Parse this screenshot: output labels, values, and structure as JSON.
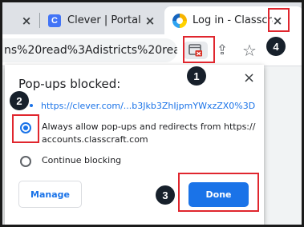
{
  "tabs": [
    {
      "title": "",
      "close": "×"
    },
    {
      "title": "Clever | Portal",
      "icon_letter": "C",
      "close": "×"
    },
    {
      "title": "Log in - Classcraft",
      "close": "×"
    }
  ],
  "toolbar": {
    "url": "ns%20read%3Adistricts%20read...",
    "icons": [
      "popup-blocked-icon",
      "share-icon",
      "star-icon"
    ],
    "share_glyph": "⇪",
    "star_glyph": "☆"
  },
  "dialog": {
    "title": "Pop-ups blocked:",
    "close": "×",
    "link": "https://clever.com/...b3Jkb3ZhIjpmYWxzZX0%3D",
    "options": [
      {
        "label_line1": "Always allow pop-ups and redirects from https://",
        "label_line2": "accounts.classcraft.com",
        "selected": true
      },
      {
        "label_line1": "Continue blocking",
        "selected": false
      }
    ],
    "manage_label": "Manage",
    "done_label": "Done"
  },
  "annotations": {
    "step1": "1",
    "step2": "2",
    "step3": "3",
    "step4": "4",
    "color": "#e0262e"
  },
  "colors": {
    "accent": "#1a73e8",
    "tabstrip": "#dee1e6",
    "badge": "#17202b"
  }
}
